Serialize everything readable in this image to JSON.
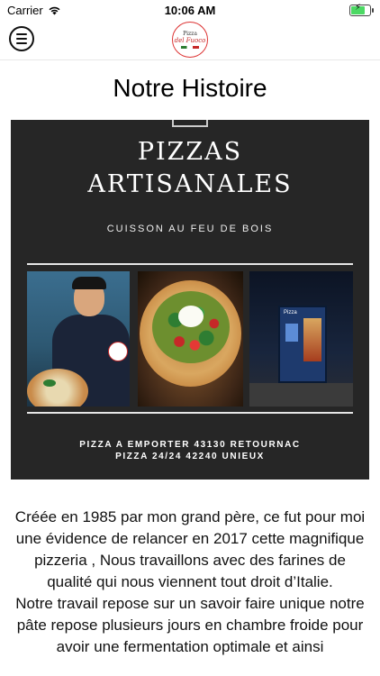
{
  "status_bar": {
    "carrier": "Carrier",
    "time": "10:06 AM",
    "battery_level": 0.85,
    "wifi_icon": "wifi-icon",
    "battery_color": "#4cd964"
  },
  "header": {
    "menu_icon": "menu-icon",
    "logo": {
      "line1": "Pizza",
      "line2": "del Fuoco"
    }
  },
  "page": {
    "title": "Notre Histoire"
  },
  "banner": {
    "title_line1": "PIZZAS",
    "title_line2": "ARTISANALES",
    "subtitle": "CUISSON AU FEU DE BOIS",
    "footer_line1": "PIZZA A EMPORTER 43130 RETOURNAC",
    "footer_line2": "PIZZA 24/24 42240 UNIEUX",
    "machine_sign": "Pizza",
    "background_color": "#262626"
  },
  "story": {
    "paragraph1": "Créée en 1985 par mon grand père, ce fut pour moi une évidence de relancer en 2017 cette magnifique pizzeria , Nous travaillons avec des farines de qualité qui nous viennent tout droit d’Italie.",
    "paragraph2": "Notre travail repose sur un savoir faire unique notre pâte repose plusieurs jours en chambre froide pour avoir une fermentation optimale et ainsi"
  }
}
